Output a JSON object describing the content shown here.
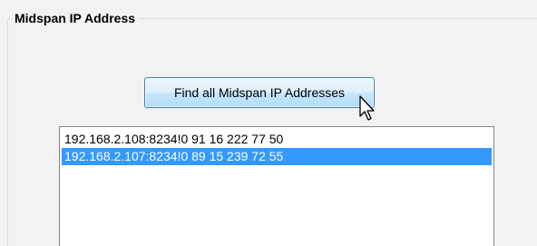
{
  "group": {
    "title": "Midspan IP Address"
  },
  "button": {
    "label": "Find all Midspan IP Addresses"
  },
  "list": {
    "items": [
      {
        "text": "192.168.2.108:8234!0 91 16 222 77 50",
        "selected": false
      },
      {
        "text": "192.168.2.107:8234!0 89 15 239 72 55",
        "selected": true
      }
    ]
  },
  "colors": {
    "selection": "#3399ff",
    "button_border": "#3c7fb1",
    "background": "#f2f2f2"
  },
  "icons": {
    "cursor": "mouse-pointer-icon"
  }
}
